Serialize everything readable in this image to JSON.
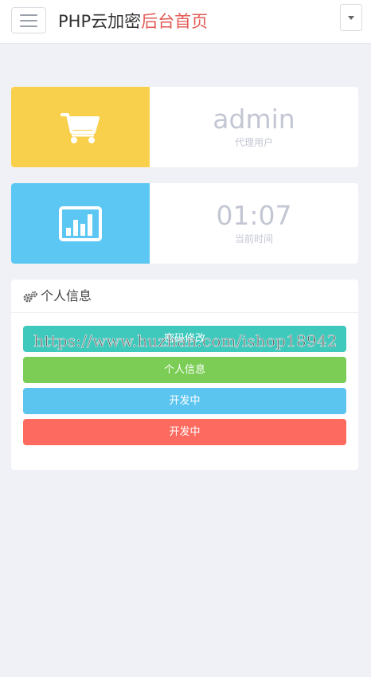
{
  "header": {
    "brand_main": "PHP云加密",
    "brand_accent": "后台首页"
  },
  "stats": [
    {
      "value": "admin",
      "label": "代理用户",
      "icon": "cart-icon",
      "color": "#f8d04b"
    },
    {
      "value": "01:07",
      "label": "当前时间",
      "icon": "bar-chart-icon",
      "color": "#5bc7f2"
    }
  ],
  "panel": {
    "title": "个人信息",
    "icon": "gears-icon",
    "buttons": [
      {
        "label": "密码修改",
        "color": "#3fc9bd"
      },
      {
        "label": "个人信息",
        "color": "#7ccd55"
      },
      {
        "label": "开发中",
        "color": "#5bc5f0"
      },
      {
        "label": "开发中",
        "color": "#fd6b60"
      }
    ]
  },
  "watermark": "https://www.huzhan.com/ishop18942",
  "colors": {
    "accent": "#e35b55",
    "background": "#f0f1f6"
  }
}
